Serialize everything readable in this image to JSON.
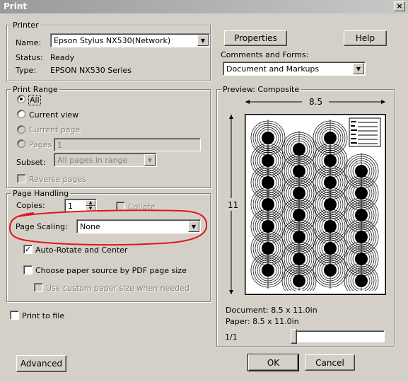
{
  "window": {
    "title": "Print",
    "close_glyph": "×"
  },
  "printer": {
    "legend": "Printer",
    "name_label": "Name:",
    "name_value": "Epson Stylus NX530(Network)",
    "status_label": "Status:",
    "status_value": "Ready",
    "type_label": "Type:",
    "type_value": "EPSON NX530 Series",
    "properties_button": "Properties",
    "help_button": "Help",
    "comments_label": "Comments and Forms:",
    "comments_value": "Document and Markups"
  },
  "print_range": {
    "legend": "Print Range",
    "all": "All",
    "current_view": "Current view",
    "current_page": "Current page",
    "pages": "Pages",
    "pages_value": "1",
    "subset_label": "Subset:",
    "subset_value": "All pages in range",
    "reverse_pages": "Reverse pages"
  },
  "page_handling": {
    "legend": "Page Handling",
    "copies_label": "Copies:",
    "copies_value": "1",
    "collate": "Collate",
    "page_scaling_label": "Page Scaling:",
    "page_scaling_value": "None",
    "auto_rotate": "Auto-Rotate and Center",
    "auto_rotate_checked": "✓",
    "paper_source": "Choose paper source by PDF page size",
    "custom_paper": "Use custom paper size when needed"
  },
  "print_to_file": "Print to file",
  "preview": {
    "legend": "Preview: Composite",
    "width_label": "8.5",
    "height_label": "11",
    "document_size": "Document: 8.5 x 11.0in",
    "paper_size": "Paper: 8.5 x 11.0in",
    "page_counter": "1/1",
    "page_slider_fraction": 0.0
  },
  "buttons": {
    "advanced": "Advanced",
    "ok": "OK",
    "cancel": "Cancel"
  },
  "icons": {
    "dropdown": "▼",
    "spin_up": "▲",
    "spin_down": "▼"
  },
  "colors": {
    "annotation_red": "#e0161b",
    "dialog_bg": "#d4d0c8"
  }
}
